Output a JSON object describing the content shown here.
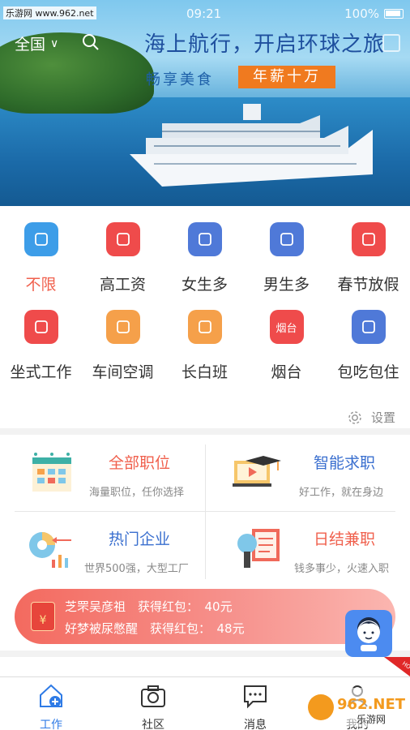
{
  "status_bar": {
    "site_label": "乐游网 www.962.net",
    "time": "09:21",
    "battery": "100%"
  },
  "header": {
    "region": "全国"
  },
  "banner": {
    "slogan_main": "海上航行，开启环球之旅",
    "slogan_sub": "畅享美食",
    "badge": "年薪十万"
  },
  "filters": [
    {
      "label": "不限",
      "icon": "whale-icon",
      "color": "#3d9de8"
    },
    {
      "label": "高工资",
      "icon": "money-icon",
      "color": "#ef4b4b"
    },
    {
      "label": "女生多",
      "icon": "female-icon",
      "color": "#4f79d8"
    },
    {
      "label": "男生多",
      "icon": "male-icon",
      "color": "#4f79d8"
    },
    {
      "label": "春节放假",
      "icon": "firework-icon",
      "color": "#ef4b4b"
    },
    {
      "label": "坐式工作",
      "icon": "chair-icon",
      "color": "#ef4b4b"
    },
    {
      "label": "车间空调",
      "icon": "aircon-icon",
      "color": "#f5a04a"
    },
    {
      "label": "长白班",
      "icon": "sun-icon",
      "color": "#f5a04a"
    },
    {
      "label": "烟台",
      "icon": "city-icon",
      "color": "#ef4b4b",
      "icon_text": "烟台"
    },
    {
      "label": "包吃包住",
      "icon": "cutlery-icon",
      "color": "#4f79d8"
    }
  ],
  "settings_label": "设置",
  "services": {
    "all_jobs": {
      "title": "全部职位",
      "desc": "海量职位，任你选择"
    },
    "smart_search": {
      "title": "智能求职",
      "desc": "好工作，就在身边"
    },
    "hot_companies": {
      "title": "热门企业",
      "desc": "世界500强，大型工厂"
    },
    "daily_pay": {
      "title": "日结兼职",
      "desc": "钱多事少，火速入职"
    }
  },
  "notice": {
    "envelope_symbol": "¥",
    "line1": "芝罘吴彦祖　获得红包：　40元",
    "line2": "好梦被尿憋醒　获得红包：　48元"
  },
  "hot_badge": "HOT",
  "tabs": [
    {
      "label": "工作",
      "icon": "home-icon"
    },
    {
      "label": "社区",
      "icon": "camera-icon"
    },
    {
      "label": "消息",
      "icon": "message-icon"
    },
    {
      "label": "我的",
      "icon": "profile-icon"
    }
  ],
  "watermark": {
    "brand": "962.NET",
    "sub": "乐游网"
  },
  "colors": {
    "accent_blue": "#2f7be6",
    "accent_red": "#f0604d",
    "title_red": "#f0604d",
    "title_blue": "#3a6fcf"
  }
}
